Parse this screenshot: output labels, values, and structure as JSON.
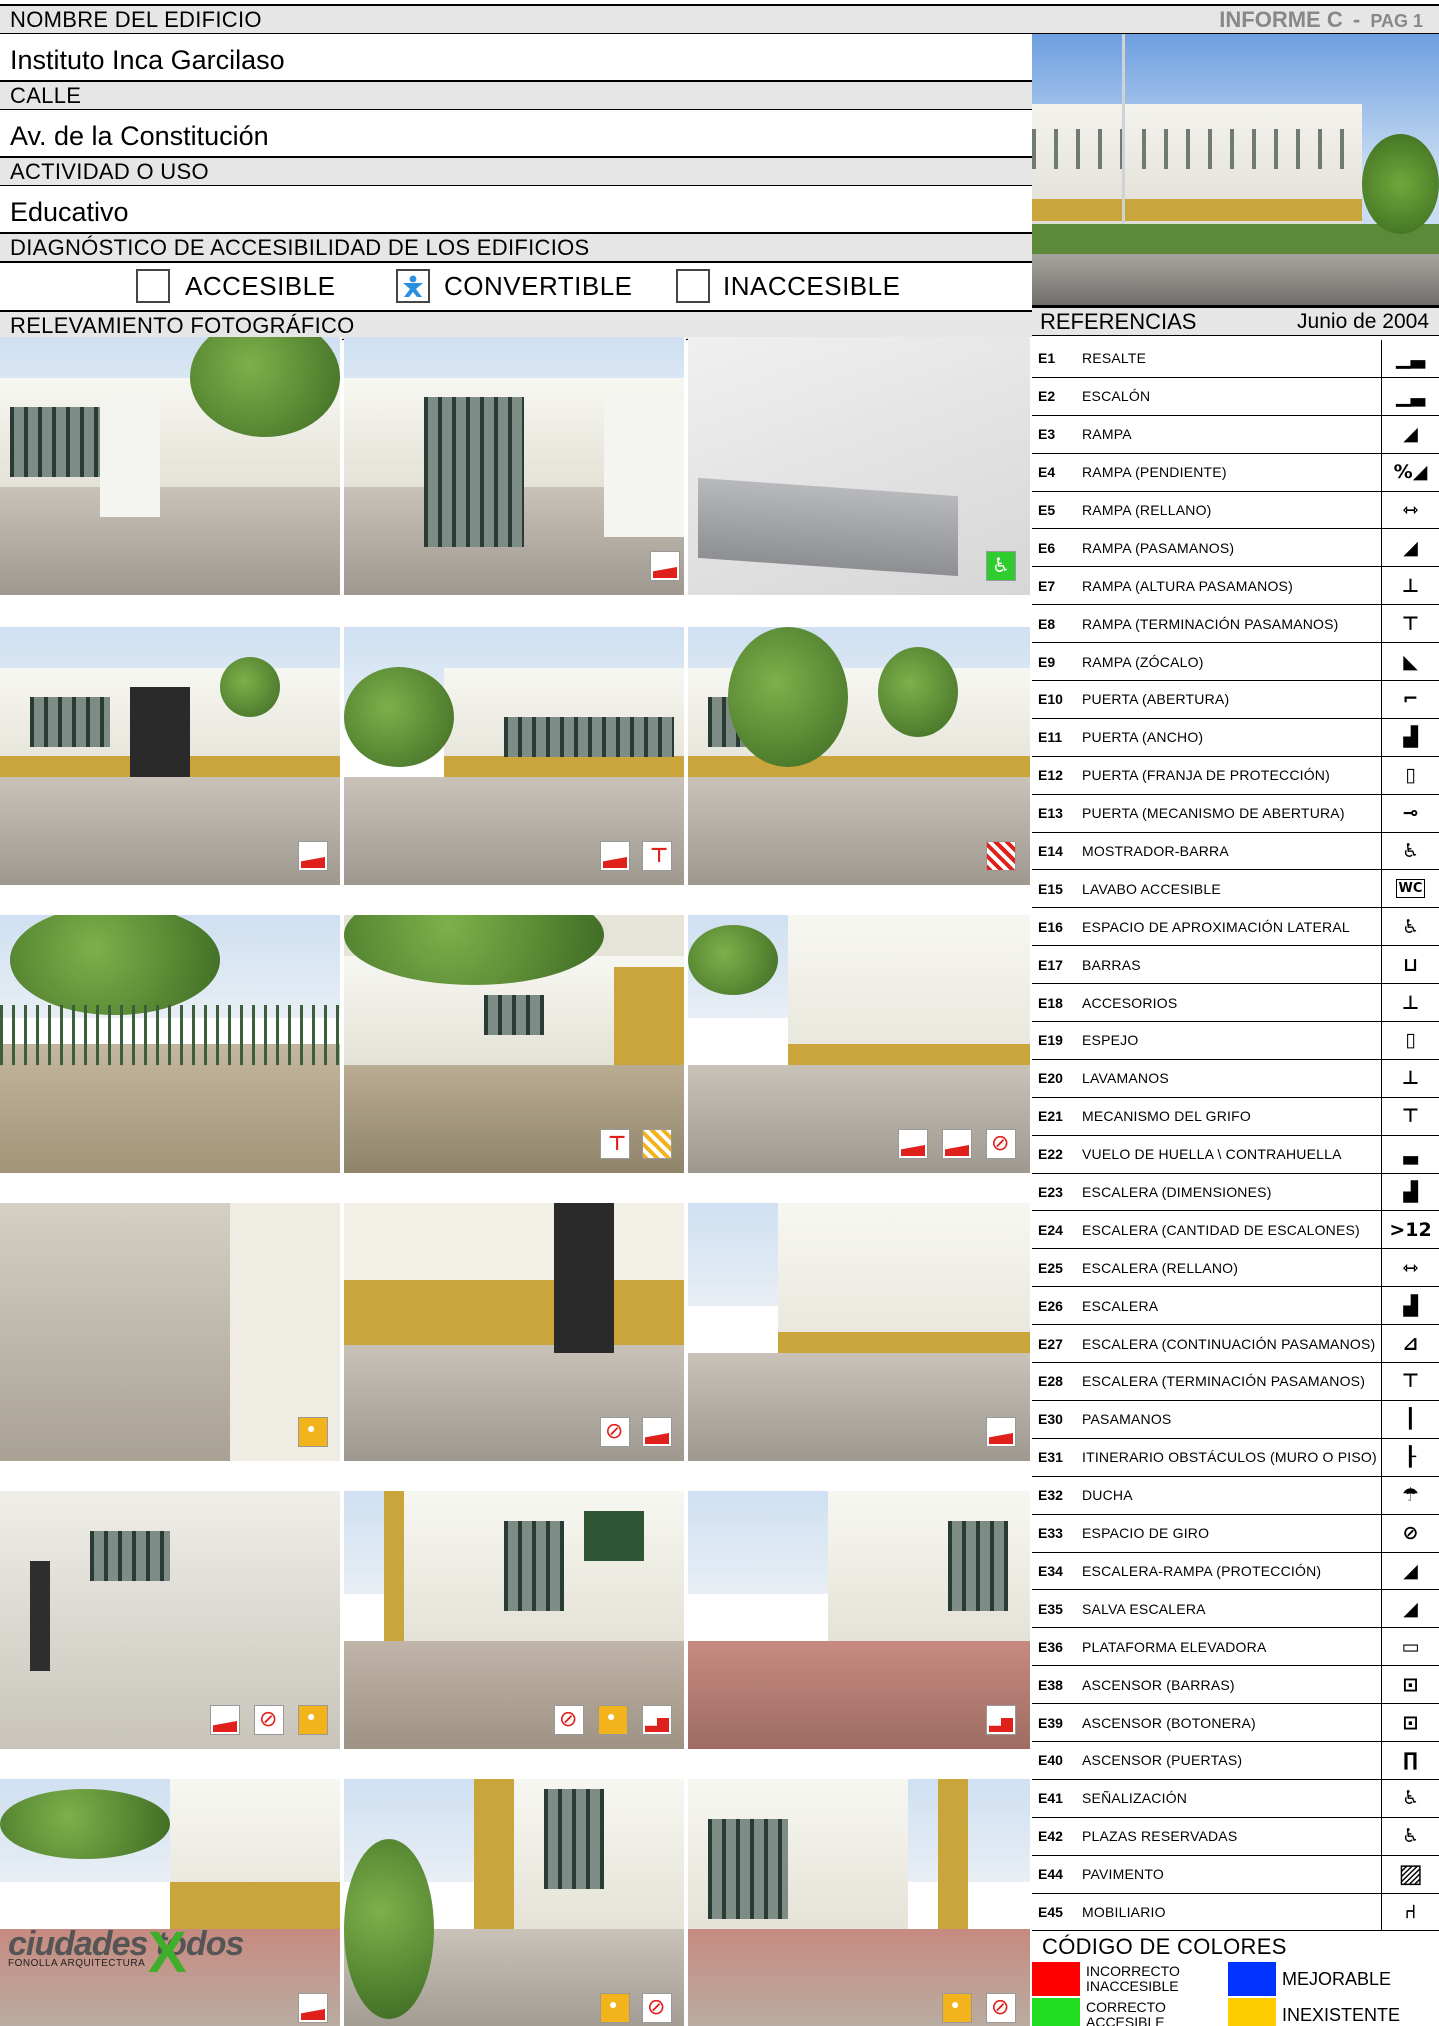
{
  "form": {
    "building_name_label": "NOMBRE DEL EDIFICIO",
    "building_name": "Instituto Inca Garcilaso",
    "street_label": "CALLE",
    "street": "Av. de la Constitución",
    "activity_label": "ACTIVIDAD O USO",
    "activity": "Educativo",
    "diagnosis_label": "DIAGNÓSTICO DE ACCESIBILIDAD DE LOS EDIFICIOS",
    "options": [
      {
        "label": "ACCESIBLE",
        "checked": false
      },
      {
        "label": "CONVERTIBLE",
        "checked": true
      },
      {
        "label": "INACCESIBLE",
        "checked": false
      }
    ],
    "photo_survey_label": "RELEVAMIENTO FOTOGRÁFICO"
  },
  "report": {
    "title": "INFORME C",
    "separator": "-",
    "page": "PAG 1"
  },
  "references": {
    "title": "REFERENCIAS",
    "date": "Junio de 2004",
    "items": [
      {
        "code": "E1",
        "name": "RESALTE",
        "icon": "step-icon"
      },
      {
        "code": "E2",
        "name": "ESCALÓN",
        "icon": "step-icon"
      },
      {
        "code": "E3",
        "name": "RAMPA",
        "icon": "ramp-icon"
      },
      {
        "code": "E4",
        "name": "RAMPA (PENDIENTE)",
        "icon": "ramp-slope-icon"
      },
      {
        "code": "E5",
        "name": "RAMPA (RELLANO)",
        "icon": "ramp-landing-icon"
      },
      {
        "code": "E6",
        "name": "RAMPA (PASAMANOS)",
        "icon": "ramp-handrail-icon"
      },
      {
        "code": "E7",
        "name": "RAMPA (ALTURA PASAMANOS)",
        "icon": "ramp-handrail-height-icon"
      },
      {
        "code": "E8",
        "name": "RAMPA (TERMINACIÓN PASAMANOS)",
        "icon": "ramp-handrail-end-icon"
      },
      {
        "code": "E9",
        "name": "RAMPA (ZÓCALO)",
        "icon": "ramp-curb-icon"
      },
      {
        "code": "E10",
        "name": "PUERTA (ABERTURA)",
        "icon": "door-opening-icon"
      },
      {
        "code": "E11",
        "name": "PUERTA (ANCHO)",
        "icon": "door-width-icon"
      },
      {
        "code": "E12",
        "name": "PUERTA (FRANJA DE PROTECCIÓN)",
        "icon": "door-strip-icon"
      },
      {
        "code": "E13",
        "name": "PUERTA (MECANISMO DE ABERTURA)",
        "icon": "door-handle-icon"
      },
      {
        "code": "E14",
        "name": "MOSTRADOR-BARRA",
        "icon": "counter-icon"
      },
      {
        "code": "E15",
        "name": "LAVABO ACCESIBLE",
        "icon": "wc-icon"
      },
      {
        "code": "E16",
        "name": "ESPACIO DE APROXIMACIÓN LATERAL",
        "icon": "lateral-space-icon"
      },
      {
        "code": "E17",
        "name": "BARRAS",
        "icon": "grab-bars-icon"
      },
      {
        "code": "E18",
        "name": "ACCESORIOS",
        "icon": "accessories-icon"
      },
      {
        "code": "E19",
        "name": "ESPEJO",
        "icon": "mirror-icon"
      },
      {
        "code": "E20",
        "name": "LAVAMANOS",
        "icon": "washbasin-icon"
      },
      {
        "code": "E21",
        "name": "MECANISMO DEL GRIFO",
        "icon": "faucet-icon"
      },
      {
        "code": "E22",
        "name": "VUELO DE HUELLA \\ CONTRAHUELLA",
        "icon": "tread-icon"
      },
      {
        "code": "E23",
        "name": "ESCALERA (DIMENSIONES)",
        "icon": "stair-dimensions-icon"
      },
      {
        "code": "E24",
        "name": "ESCALERA (CANTIDAD DE ESCALONES)",
        "icon": "stair-count-icon"
      },
      {
        "code": "E25",
        "name": "ESCALERA (RELLANO)",
        "icon": "stair-landing-icon"
      },
      {
        "code": "E26",
        "name": "ESCALERA",
        "icon": "stair-icon"
      },
      {
        "code": "E27",
        "name": "ESCALERA (CONTINUACIÓN PASAMANOS)",
        "icon": "stair-handrail-icon"
      },
      {
        "code": "E28",
        "name": "ESCALERA (TERMINACIÓN PASAMANOS)",
        "icon": "stair-handrail-end-icon"
      },
      {
        "code": "E30",
        "name": "PASAMANOS",
        "icon": "handrail-icon"
      },
      {
        "code": "E31",
        "name": "ITINERARIO OBSTÁCULOS (MURO O PISO)",
        "icon": "obstacles-icon"
      },
      {
        "code": "E32",
        "name": "DUCHA",
        "icon": "shower-icon"
      },
      {
        "code": "E33",
        "name": "ESPACIO DE GIRO",
        "icon": "turning-space-icon"
      },
      {
        "code": "E34",
        "name": "ESCALERA-RAMPA (PROTECCIÓN)",
        "icon": "stair-protection-icon"
      },
      {
        "code": "E35",
        "name": "SALVA ESCALERA",
        "icon": "stair-lift-icon"
      },
      {
        "code": "E36",
        "name": "PLATAFORMA ELEVADORA",
        "icon": "platform-lift-icon"
      },
      {
        "code": "E38",
        "name": "ASCENSOR (BARRAS)",
        "icon": "elevator-bars-icon"
      },
      {
        "code": "E39",
        "name": "ASCENSOR (BOTONERA)",
        "icon": "elevator-buttons-icon"
      },
      {
        "code": "E40",
        "name": "ASCENSOR (PUERTAS)",
        "icon": "elevator-doors-icon"
      },
      {
        "code": "E41",
        "name": "SEÑALIZACIÓN",
        "icon": "signage-icon"
      },
      {
        "code": "E42",
        "name": "PLAZAS RESERVADAS",
        "icon": "reserved-parking-icon"
      },
      {
        "code": "E44",
        "name": "PAVIMENTO",
        "icon": "pavement-icon"
      },
      {
        "code": "E45",
        "name": "MOBILIARIO",
        "icon": "furniture-icon"
      }
    ]
  },
  "color_code": {
    "title": "CÓDIGO DE COLORES",
    "items": [
      {
        "label": "INCORRECTO INACCESIBLE",
        "color": "#ff0000"
      },
      {
        "label": "MEJORABLE",
        "color": "#0033ff"
      },
      {
        "label": "CORRECTO ACCESIBLE",
        "color": "#22dd22"
      },
      {
        "label": "INEXISTENTE",
        "color": "#ffcc00"
      }
    ]
  },
  "logo": {
    "text": "ciudades todos",
    "subtitle": "FONOLLA ARQUITECTURA"
  }
}
